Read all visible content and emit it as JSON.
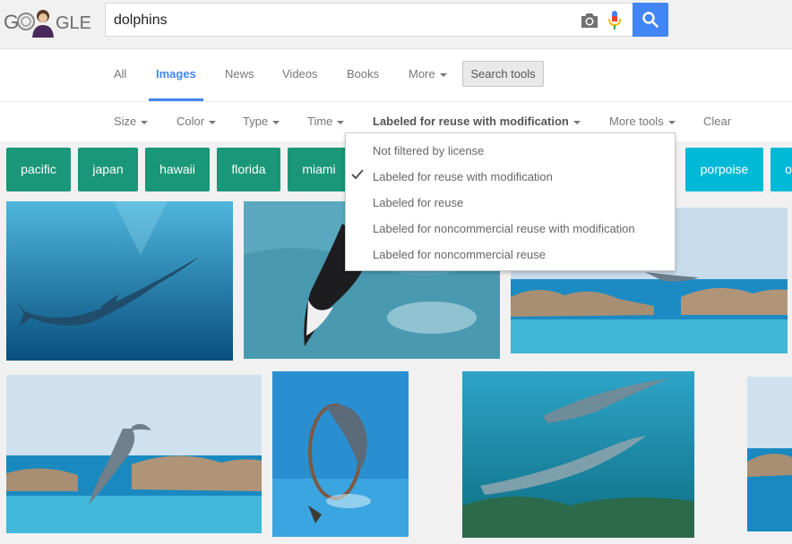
{
  "logo": {
    "alt": "Google doodle",
    "text_left": "G",
    "text_right": "GLE"
  },
  "search": {
    "query": "dolphins"
  },
  "tabs": [
    {
      "label": "All"
    },
    {
      "label": "Images"
    },
    {
      "label": "News"
    },
    {
      "label": "Videos"
    },
    {
      "label": "Books"
    },
    {
      "label": "More"
    }
  ],
  "search_tools_label": "Search tools",
  "tools": [
    {
      "label": "Size"
    },
    {
      "label": "Color"
    },
    {
      "label": "Type"
    },
    {
      "label": "Time"
    },
    {
      "label": "Labeled for reuse with modification"
    },
    {
      "label": "More tools"
    },
    {
      "label": "Clear"
    }
  ],
  "license_menu": [
    {
      "label": "Not filtered by license",
      "checked": false
    },
    {
      "label": "Labeled for reuse with modification",
      "checked": true
    },
    {
      "label": "Labeled for reuse",
      "checked": false
    },
    {
      "label": "Labeled for noncommercial reuse with modification",
      "checked": false
    },
    {
      "label": "Labeled for noncommercial reuse",
      "checked": false
    }
  ],
  "chips": [
    {
      "label": "pacific"
    },
    {
      "label": "japan"
    },
    {
      "label": "hawaii"
    },
    {
      "label": "florida"
    },
    {
      "label": "miami"
    },
    {
      "label": "porpoise"
    },
    {
      "label": "o"
    }
  ],
  "colors": {
    "accent": "#4285f4",
    "chip_teal": "#1a9678",
    "chip_cyan": "#00b9d6"
  },
  "icons": [
    "camera-icon",
    "microphone-icon",
    "search-icon",
    "checkmark-icon",
    "caret-down-icon"
  ]
}
